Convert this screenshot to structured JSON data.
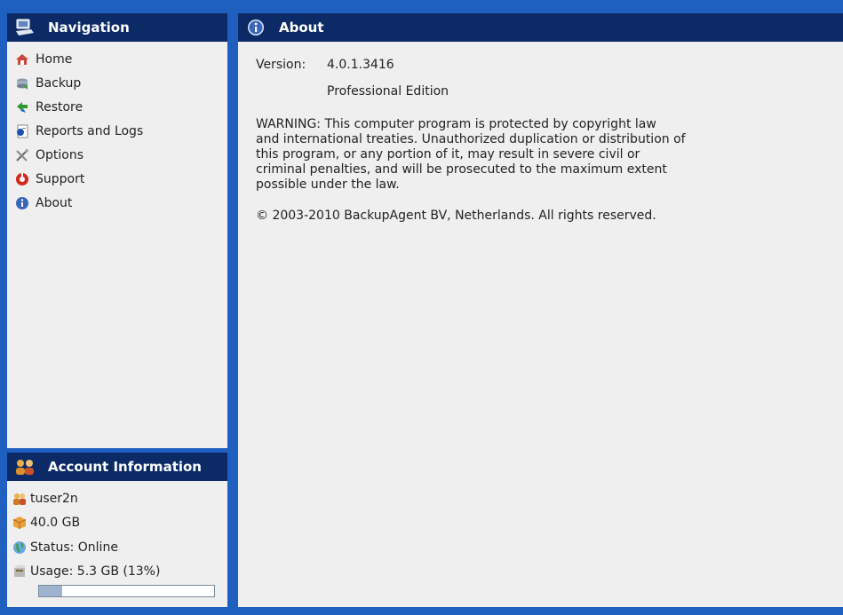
{
  "nav": {
    "title": "Navigation",
    "items": [
      {
        "label": "Home",
        "icon": "home-icon"
      },
      {
        "label": "Backup",
        "icon": "backup-icon"
      },
      {
        "label": "Restore",
        "icon": "restore-icon"
      },
      {
        "label": "Reports and Logs",
        "icon": "reports-icon"
      },
      {
        "label": "Options",
        "icon": "options-icon"
      },
      {
        "label": "Support",
        "icon": "support-icon"
      },
      {
        "label": "About",
        "icon": "info-icon"
      }
    ]
  },
  "account": {
    "title": "Account Information",
    "username": "tuser2n",
    "quota": "40.0 GB",
    "status": "Status: Online",
    "usage": "Usage: 5.3 GB (13%)",
    "usage_fraction": 0.13
  },
  "about": {
    "title": "About",
    "version_label": "Version:",
    "version_value": "4.0.1.3416",
    "edition": "Professional Edition",
    "warning_lines": [
      "WARNING: This computer program is protected by copyright law",
      "and international treaties. Unauthorized duplication or distribution of",
      "this program, or any portion of it, may result in severe civil or",
      "criminal penalties, and will be prosecuted to the maximum extent",
      "possible under the law."
    ],
    "copyright": "© 2003-2010 BackupAgent BV, Netherlands. All rights reserved."
  },
  "colors": {
    "background": "#1f5fbf",
    "header": "#0b2a66",
    "panel": "#efefef"
  }
}
